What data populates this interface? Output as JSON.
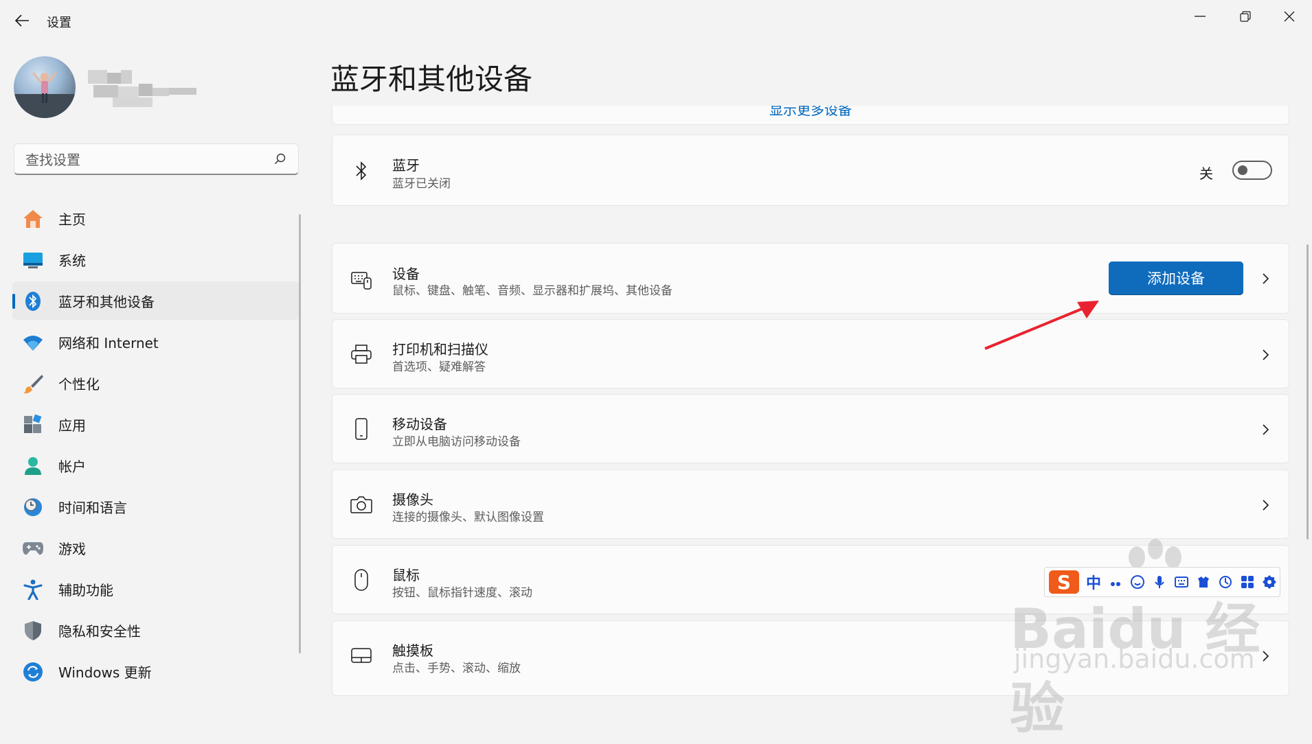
{
  "app": {
    "title": "设置"
  },
  "search": {
    "placeholder": "查找设置"
  },
  "sidebar": {
    "items": [
      {
        "label": "主页",
        "icon": "home-icon"
      },
      {
        "label": "系统",
        "icon": "monitor-icon"
      },
      {
        "label": "蓝牙和其他设备",
        "icon": "bluetooth-icon",
        "active": true
      },
      {
        "label": "网络和 Internet",
        "icon": "wifi-icon"
      },
      {
        "label": "个性化",
        "icon": "paintbrush-icon"
      },
      {
        "label": "应用",
        "icon": "apps-icon"
      },
      {
        "label": "帐户",
        "icon": "person-icon"
      },
      {
        "label": "时间和语言",
        "icon": "clock-globe-icon"
      },
      {
        "label": "游戏",
        "icon": "gamepad-icon"
      },
      {
        "label": "辅助功能",
        "icon": "accessibility-icon"
      },
      {
        "label": "隐私和安全性",
        "icon": "shield-icon"
      },
      {
        "label": "Windows 更新",
        "icon": "update-icon"
      }
    ]
  },
  "main": {
    "title": "蓝牙和其他设备",
    "show_more": "显示更多设备",
    "bluetooth": {
      "title": "蓝牙",
      "subtitle": "蓝牙已关闭",
      "toggle_label": "关",
      "toggle_on": false
    },
    "cards": [
      {
        "title": "设备",
        "subtitle": "鼠标、键盘、触笔、音频、显示器和扩展坞、其他设备",
        "button": "添加设备",
        "icon": "devices-icon"
      },
      {
        "title": "打印机和扫描仪",
        "subtitle": "首选项、疑难解答",
        "icon": "printer-icon"
      },
      {
        "title": "移动设备",
        "subtitle": "立即从电脑访问移动设备",
        "icon": "phone-icon"
      },
      {
        "title": "摄像头",
        "subtitle": "连接的摄像头、默认图像设置",
        "icon": "camera-icon"
      },
      {
        "title": "鼠标",
        "subtitle": "按钮、鼠标指针速度、滚动",
        "icon": "mouse-icon"
      },
      {
        "title": "触摸板",
        "subtitle": "点击、手势、滚动、缩放",
        "icon": "touchpad-icon"
      }
    ]
  },
  "ime": {
    "mode": "中"
  },
  "watermark": {
    "text": "Baidu 经验",
    "sub": "jingyan.baidu.com"
  },
  "colors": {
    "accent": "#0067c0",
    "button": "#0f6cbd",
    "annotation_arrow": "#e8232f",
    "ime_logo": "#f05a1a"
  }
}
